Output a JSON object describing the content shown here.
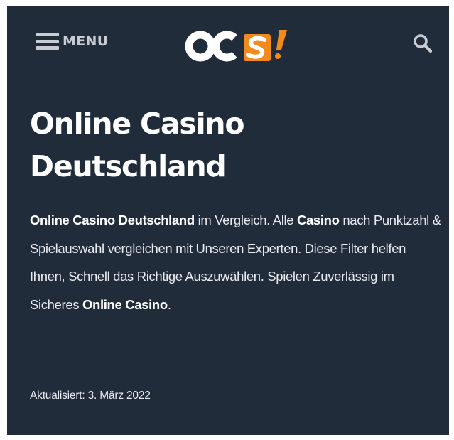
{
  "header": {
    "menu_label": "MENU",
    "logo_text": "OCS!"
  },
  "article": {
    "title": "Online Casino Deutschland",
    "intro": {
      "p1_bold": "Online Casino Deutschland",
      "p1_text": " im Vergleich. Alle ",
      "p2_bold": "Casino",
      "p2_text": " nach Punktzahl & Spielauswahl vergleichen mit Unseren Experten. Diese Filter helfen Ihnen, Schnell das Richtige Auszuwählen. Spielen Zuverlässig im Sicheres ",
      "p3_bold": "Online Casino",
      "p3_text": "."
    },
    "updated": "Aktualisiert: 3. März 2022"
  },
  "colors": {
    "background": "#212c3b",
    "logo_accent": "#f28a1d",
    "text": "#ffffff",
    "icon_muted": "#c8ccd2"
  },
  "icons": {
    "menu": "hamburger-icon",
    "search": "search-icon"
  }
}
